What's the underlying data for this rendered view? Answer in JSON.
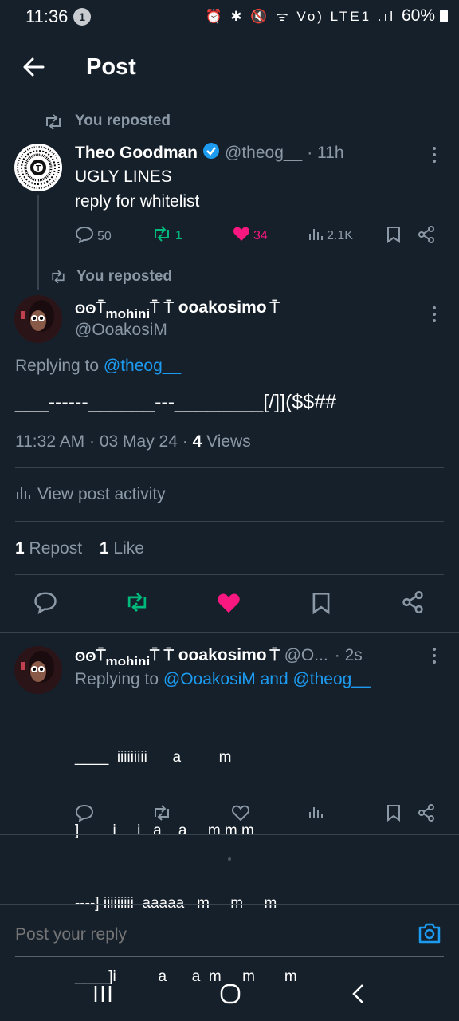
{
  "status_bar": {
    "time": "11:36",
    "notif_count": "1",
    "icons": "⏰ ✱ 🔇 ᯤ Vo) LTE1 .ıl",
    "battery": "60%"
  },
  "header": {
    "title": "Post"
  },
  "repost1": {
    "label": "You reposted"
  },
  "post1": {
    "author": "Theo Goodman",
    "handle": "@theog__",
    "time": "· 11h",
    "line1": "UGLY LINES",
    "line2": "reply for whitelist",
    "replies": "50",
    "reposts": "1",
    "likes": "34",
    "views": "2.1K"
  },
  "repost2": {
    "label": "You reposted"
  },
  "main_post": {
    "author": "ʘʘ⍑mohini⍑⍑ooakosimo⍑",
    "author_a": "ʘʘ",
    "author_b": "mohini",
    "author_c": "ooakosimo",
    "handle": "@OoakosiM",
    "replying_prefix": "Replying to ",
    "replying_to": "@theog__",
    "body": "___------______---________[/]]($$##",
    "meta_time": "11:32 AM · 03 May 24 · ",
    "meta_views_count": "4",
    "meta_views_label": " Views",
    "activity": "View post activity",
    "repost_count": "1",
    "repost_label": " Repost",
    "like_count": "1",
    "like_label": " Like"
  },
  "reply": {
    "author_a": "ʘʘ",
    "author_b": "mohini",
    "author_c": "ooakosimo",
    "handle": "@O...",
    "time": "· 2s",
    "replying_prefix": "Replying to ",
    "replying_to": "@OoakosiM and @theog__",
    "lines": [
      "____  iiiiiiiii      a         m",
      "]        i     i   a    a     m m m",
      "----] iiiiiiiii  aaaaa   m     m     m",
      "____]i          a      a  m     m       m"
    ]
  },
  "composer": {
    "placeholder": "Post your reply"
  },
  "colors": {
    "background": "#15202b",
    "accent": "#1d9bf0",
    "repost": "#00ba7c",
    "like": "#f91880",
    "muted": "#8b98a5"
  }
}
